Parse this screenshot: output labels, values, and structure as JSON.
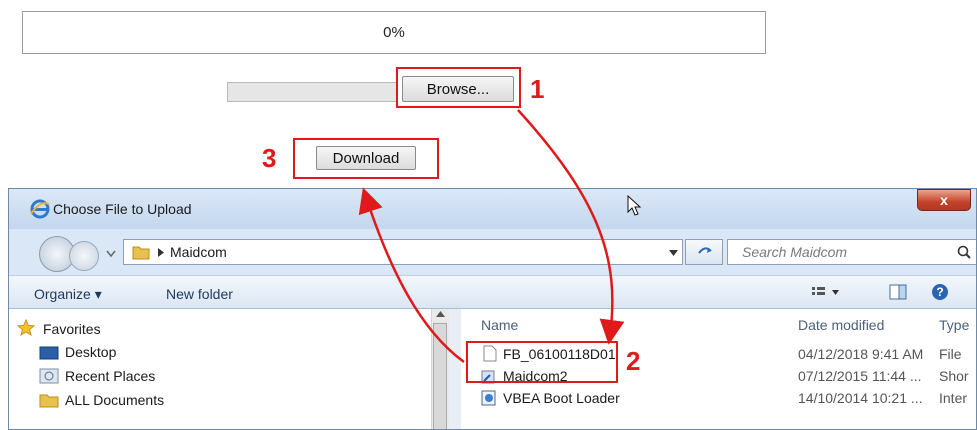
{
  "progress": {
    "label": "0%",
    "value": 0
  },
  "browse": {
    "label": "Browse..."
  },
  "download": {
    "label": "Download"
  },
  "steps": {
    "one": "1",
    "two": "2",
    "three": "3"
  },
  "dialog": {
    "title": "Choose File to Upload",
    "close_label": "x",
    "breadcrumb": "Maidcom",
    "search_placeholder": "Search Maidcom",
    "commands": {
      "organize": "Organize ▾",
      "new_folder": "New folder"
    },
    "nav_items": [
      {
        "label": "Favorites",
        "icon": "star-icon"
      },
      {
        "label": "Desktop",
        "icon": "desktop-icon"
      },
      {
        "label": "Recent Places",
        "icon": "recent-places-icon"
      },
      {
        "label": "ALL Documents",
        "icon": "folder-icon"
      }
    ],
    "columns": {
      "name": "Name",
      "date": "Date modified",
      "type": "Type"
    },
    "files": [
      {
        "name": "FB_06100118D01",
        "date": "04/12/2018 9:41 AM",
        "type": "File",
        "icon": "file-icon"
      },
      {
        "name": "Maidcom2",
        "date": "07/12/2015 11:44 ...",
        "type": "Shor",
        "icon": "shortcut-icon"
      },
      {
        "name": "VBEA Boot Loader",
        "date": "14/10/2014 10:21 ...",
        "type": "Inter",
        "icon": "internet-shortcut-icon"
      }
    ]
  },
  "colors": {
    "annotation_red": "#e0191b",
    "title_bar": "#c4d7ee",
    "link_blue": "#1e395b"
  }
}
